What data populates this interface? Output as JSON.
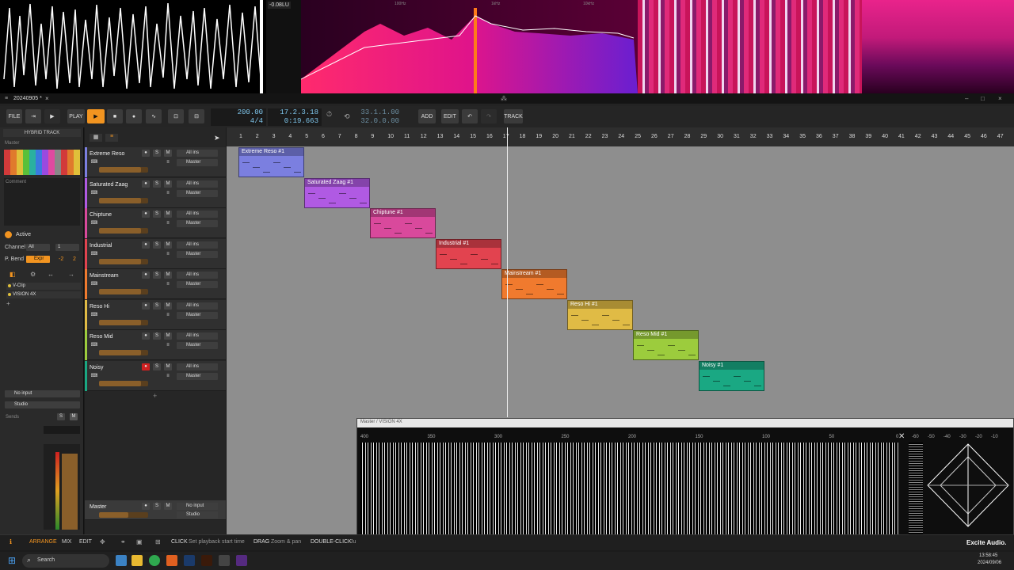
{
  "meter_readout": "-0.08LU",
  "spectrum_scale": [
    "100Hz",
    "1kHz",
    "10kHz"
  ],
  "project_tab": "20240905 *",
  "toolbar": {
    "file": "FILE",
    "play": "PLAY",
    "tempo": "200.00",
    "timesig": "4/4",
    "position": "17.2.3.18",
    "time": "0:19.663",
    "loop_start": "33.1.1.00",
    "loop_len": "32.0.0.00",
    "add": "ADD",
    "edit": "EDIT",
    "track": "TRACK"
  },
  "inspector": {
    "title": "HYBRID TRACK",
    "master": "Master",
    "comment": "Comment",
    "active": "Active",
    "channel_label": "Channel",
    "channel_all": "All",
    "channel_num": "1",
    "pbend_label": "P. Bend",
    "pbend_mode": "Expr",
    "pbend_range_lo": "-2",
    "pbend_range_hi": "2",
    "devices": [
      "V-Clip",
      "VISION 4X"
    ],
    "input": "No input",
    "output": "Studio",
    "sends": "Sends"
  },
  "tracks": [
    {
      "name": "Extreme Reso",
      "color": "#7b7fe0",
      "input": "All ins",
      "output": "Master"
    },
    {
      "name": "Saturated Zaag",
      "color": "#b05ae3",
      "input": "All ins",
      "output": "Master"
    },
    {
      "name": "Chiptune",
      "color": "#d9499c",
      "input": "All ins",
      "output": "Master"
    },
    {
      "name": "Industrial",
      "color": "#e2434f",
      "input": "All ins",
      "output": "Master"
    },
    {
      "name": "Mainstream",
      "color": "#f07a2e",
      "input": "All ins",
      "output": "Master"
    },
    {
      "name": "Reso Hi",
      "color": "#e0bb45",
      "input": "All ins",
      "output": "Master"
    },
    {
      "name": "Reso Mid",
      "color": "#9ccc3d",
      "input": "All ins",
      "output": "Master"
    },
    {
      "name": "Noisy",
      "color": "#1aa883",
      "input": "All ins",
      "output": "Master"
    }
  ],
  "clips": [
    "Extreme Reso #1",
    "Saturated Zaag #1",
    "Chiptune #1",
    "Industrial #1",
    "Mainstream #1",
    "Reso Hi #1",
    "Reso Mid #1",
    "Noisy #1"
  ],
  "master_track": {
    "name": "Master",
    "input": "No input",
    "output": "Studio"
  },
  "bars": [
    "1",
    "2",
    "3",
    "4",
    "5",
    "6",
    "7",
    "8",
    "9",
    "10",
    "11",
    "12",
    "13",
    "14",
    "15",
    "16",
    "17",
    "18",
    "19",
    "20",
    "21",
    "22",
    "23",
    "24",
    "25",
    "26",
    "27",
    "28",
    "29",
    "30",
    "31",
    "32",
    "33",
    "34",
    "35",
    "36",
    "37",
    "38",
    "39",
    "40",
    "41",
    "42",
    "43",
    "44",
    "45",
    "46",
    "47"
  ],
  "vision": {
    "title": "Master / VISION 4X",
    "scale": [
      "400",
      "350",
      "300",
      "250",
      "200",
      "150",
      "100",
      "50",
      "0"
    ],
    "db_scale": [
      "-60",
      "-50",
      "-40",
      "-30",
      "-20",
      "-10"
    ],
    "brand": "Excite Audio."
  },
  "bottombar": {
    "arrange": "ARRANGE",
    "mix": "MIX",
    "edit": "EDIT",
    "hint1_key": "CLICK",
    "hint1": "Set playback start time",
    "hint2_key": "DRAG",
    "hint2": "Zoom & pan",
    "hint3_key": "DOUBLE-CLICK",
    "hint3": "Ju"
  },
  "taskbar": {
    "search": "Search",
    "time": "13:58:45",
    "date": "2024/09/06"
  },
  "colors": {
    "accent": "#f29420",
    "lcd": "#7fc6ec"
  }
}
